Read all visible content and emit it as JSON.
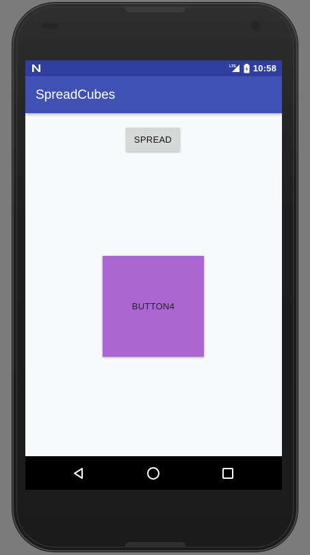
{
  "status_bar": {
    "time": "10:58",
    "left_icon": "n-notification-icon",
    "network_label": "LTE",
    "icons": [
      "lte-signal-icon",
      "battery-icon"
    ]
  },
  "app_bar": {
    "title": "SpreadCubes"
  },
  "main": {
    "spread_button_label": "SPREAD",
    "cube_button_label": "BUTTON4",
    "cube_color": "#ab66d1"
  },
  "nav_bar": {
    "buttons": [
      "back-icon",
      "home-icon",
      "recents-icon"
    ]
  },
  "colors": {
    "status_bar": "#303f9f",
    "app_bar": "#3f51b5",
    "background": "#f8f9fb",
    "spread_button": "#d6d7d7"
  }
}
